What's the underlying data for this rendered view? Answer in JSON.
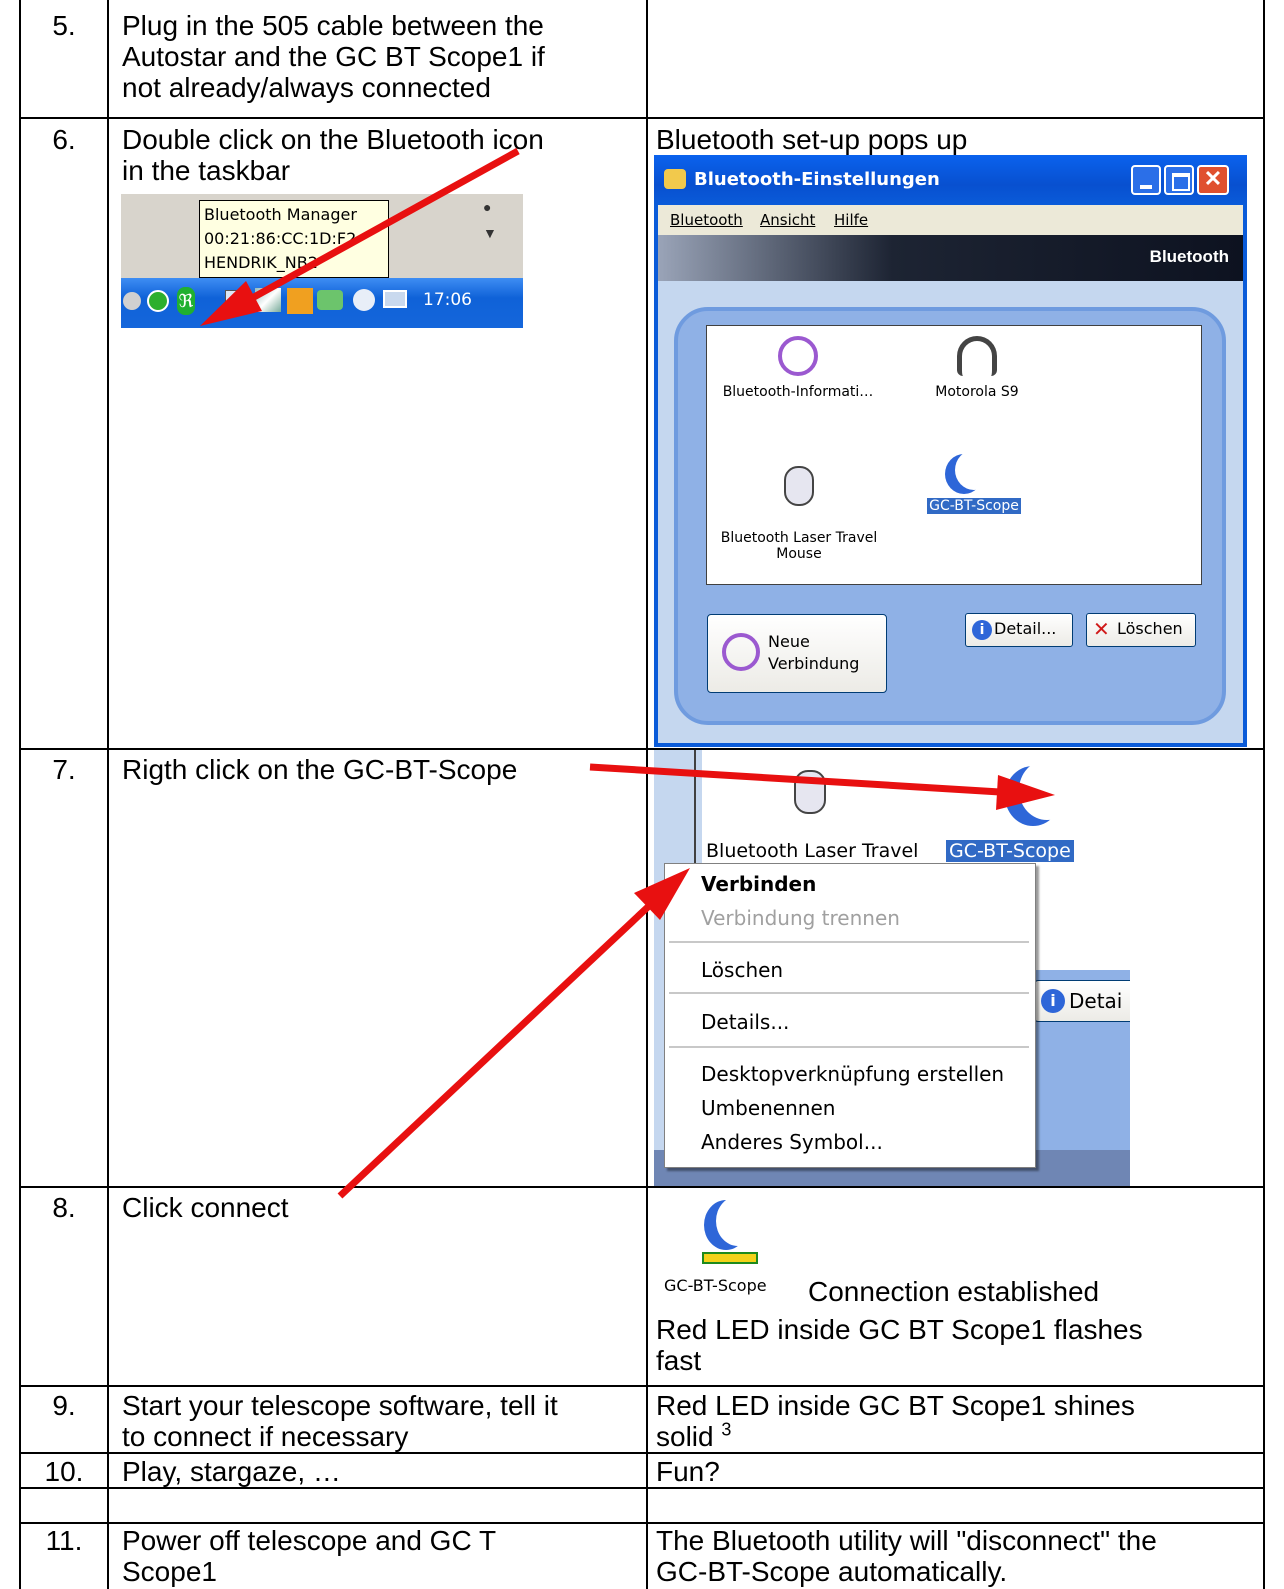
{
  "rows": [
    {
      "num": "5.",
      "left": "Plug in the 505 cable between the\nAutostar and the GC BT Scope1 if\nnot already/always connected",
      "right": ""
    },
    {
      "num": "6.",
      "left": "Double click on the Bluetooth icon\nin the taskbar",
      "right": "Bluetooth set-up pops up"
    },
    {
      "num": "7.",
      "left": "Rigth click on the GC-BT-Scope",
      "right": ""
    },
    {
      "num": "8.",
      "left": "Click connect",
      "right_a": "Connection established",
      "right_b": "Red LED inside GC BT Scope1 flashes\nfast"
    },
    {
      "num": "9.",
      "left": "Start your telescope software, tell it\nto connect if necessary",
      "right": "Red LED inside GC BT Scope1 shines\nsolid ",
      "footnote": "3"
    },
    {
      "num": "10.",
      "left": "Play, stargaze, …",
      "right": "Fun?"
    },
    {
      "num": "11.",
      "left": "Power off telescope and GC T\nScope1",
      "right": "The Bluetooth utility will \"disconnect\" the\nGC-BT-Scope automatically."
    }
  ],
  "taskbar": {
    "tooltip_lines": [
      "Bluetooth Manager",
      "00:21:86:CC:1D:F2",
      "HENDRIK_NB2"
    ],
    "clock": "17:06"
  },
  "bt_window": {
    "title": "Bluetooth-Einstellungen",
    "menu": [
      "Bluetooth",
      "Ansicht",
      "Hilfe"
    ],
    "brand": "Bluetooth",
    "devices": [
      {
        "label": "Bluetooth-Informati…",
        "icon": "bluetooth-info-icon"
      },
      {
        "label": "Motorola S9",
        "icon": "headphones-icon"
      },
      {
        "label": "Bluetooth Laser Travel\nMouse",
        "icon": "mouse-icon"
      },
      {
        "label": "GC-BT-Scope",
        "icon": "moon-icon"
      }
    ],
    "new_connection": "Neue\nVerbindung",
    "detail_button": "Detail...",
    "delete_button": "Löschen"
  },
  "context_shot": {
    "mouse_label": "Bluetooth Laser Travel",
    "scope_label": "GC-BT-Scope",
    "partial_button": "Detai",
    "menu_items": [
      {
        "label": "Verbinden",
        "state": "bold"
      },
      {
        "label": "Verbindung trennen",
        "state": "disabled"
      },
      {
        "label": "Löschen",
        "state": "normal"
      },
      {
        "label": "Details...",
        "state": "normal"
      },
      {
        "label": "Desktopverknüpfung erstellen",
        "state": "normal"
      },
      {
        "label": "Umbenennen",
        "state": "normal"
      },
      {
        "label": "Anderes Symbol...",
        "state": "normal"
      }
    ]
  },
  "connected_icon": {
    "label": "GC-BT-Scope"
  },
  "colors": {
    "xp_blue": "#0A5BD9",
    "arrow_red": "#E81010",
    "selection": "#316AC5",
    "panel": "#C5D7EF"
  }
}
